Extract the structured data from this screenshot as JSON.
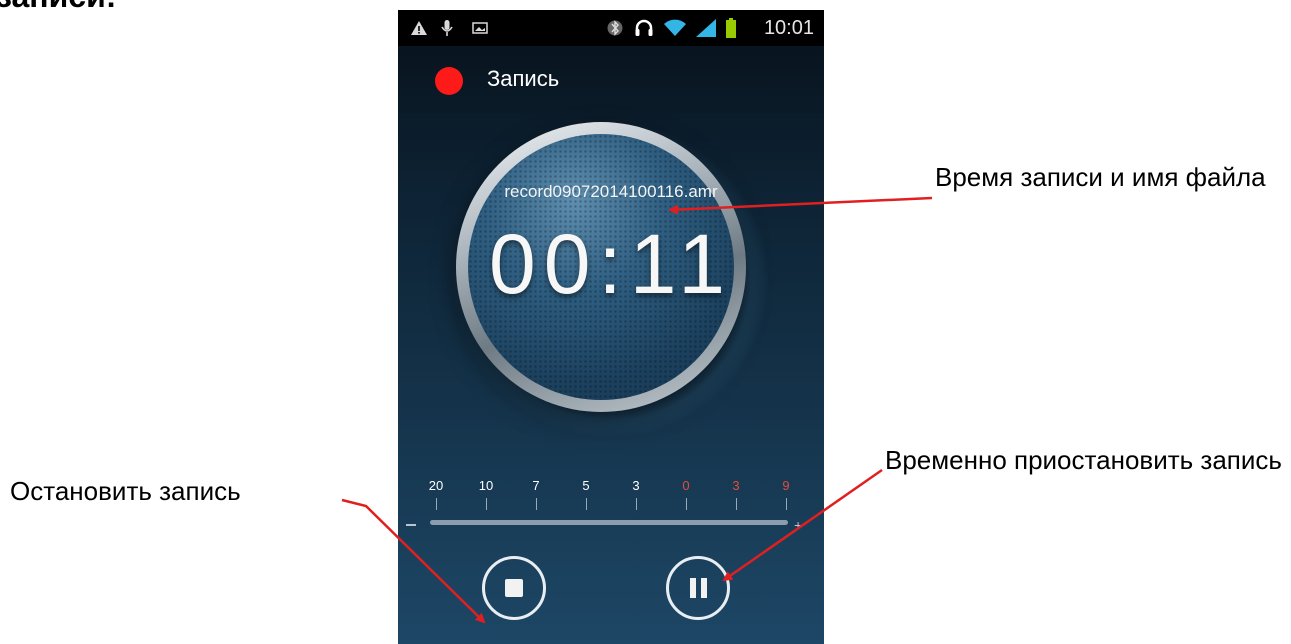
{
  "heading_cut": "записи:",
  "status_bar": {
    "left_icons": [
      "warning-icon",
      "microphone-icon",
      "image-icon"
    ],
    "right_icons": [
      "bluetooth-icon",
      "headphones-icon",
      "wifi-icon",
      "signal-icon",
      "battery-icon"
    ],
    "time": "10:01"
  },
  "recorder": {
    "title": "Запись",
    "filename": "record09072014100116.amr",
    "timer": "00:11",
    "level_scale": [
      {
        "label": "20",
        "red": false
      },
      {
        "label": "10",
        "red": false
      },
      {
        "label": "7",
        "red": false
      },
      {
        "label": "5",
        "red": false
      },
      {
        "label": "3",
        "red": false
      },
      {
        "label": "0",
        "red": true
      },
      {
        "label": "3",
        "red": true
      },
      {
        "label": "9",
        "red": true
      }
    ]
  },
  "annotations": {
    "timer_and_filename": "Время записи и имя файла",
    "stop_recording": "Остановить запись",
    "pause_recording": "Временно приостановить запись"
  },
  "colors": {
    "record_dot": "#ff1a1a",
    "scale_red": "#e34b3b",
    "arrow": "#e02020"
  }
}
